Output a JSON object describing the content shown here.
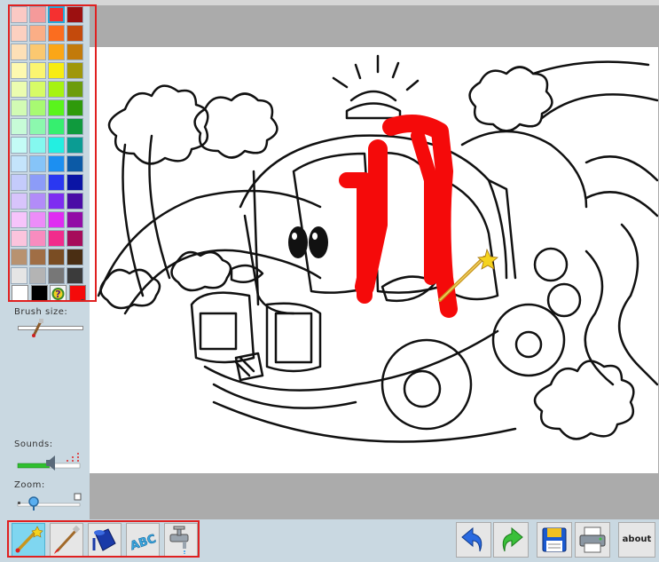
{
  "palette": {
    "rows": [
      [
        "#fbc9c4",
        "#f59a9a",
        "#f53030",
        "#9c1010"
      ],
      [
        "#fcd0c0",
        "#fbae86",
        "#fb6d1f",
        "#c44a0c"
      ],
      [
        "#fde0b7",
        "#fbc870",
        "#fba617",
        "#c27a0a"
      ],
      [
        "#fdf9b0",
        "#fbf570",
        "#f7ec12",
        "#9f970a"
      ],
      [
        "#ebfcb0",
        "#d7fb66",
        "#a6f312",
        "#6c9c0b"
      ],
      [
        "#d2fbb4",
        "#a8fa72",
        "#5af41c",
        "#2f9a0b"
      ],
      [
        "#c7fbd7",
        "#8cf8ae",
        "#36ef6f",
        "#0f9a3d"
      ],
      [
        "#c4fbf6",
        "#85f8ef",
        "#23efe1",
        "#0b9c93"
      ],
      [
        "#c4e4fb",
        "#86c4f8",
        "#1c8ff1",
        "#0c5aa6"
      ],
      [
        "#c4cbfb",
        "#8c9cf8",
        "#2a38f1",
        "#0a14a5"
      ],
      [
        "#d8c4fb",
        "#b28cf8",
        "#7e2cf1",
        "#4a0ca6"
      ],
      [
        "#f6c4fb",
        "#ec8cf8",
        "#df2cf1",
        "#920ca6"
      ],
      [
        "#fbc4dd",
        "#f88cbf",
        "#f12c8c",
        "#a60c5a"
      ],
      [
        "#b89270",
        "#a06e45",
        "#7a4d23",
        "#4a2e13"
      ],
      [
        "#e5e5e5",
        "#b4b4b4",
        "#777777",
        "#3b3b3b"
      ]
    ],
    "selected_swatch": "#f53030",
    "special": {
      "white": "#ffffff",
      "black": "#000000",
      "current": "#f50a0a",
      "random_icon": "question-mark-icon"
    }
  },
  "panel": {
    "brush_size_label": "Brush size:",
    "sounds_label": "Sounds:",
    "zoom_label": "Zoom:",
    "brush_size_level": 0.2,
    "sound_level": 0.5,
    "zoom_level": 0.2
  },
  "tools": [
    {
      "name": "magic-wand",
      "icon": "magic-wand-icon",
      "active": true
    },
    {
      "name": "brush",
      "icon": "brush-icon",
      "active": false
    },
    {
      "name": "paint-bucket",
      "icon": "paint-bucket-icon",
      "active": false
    },
    {
      "name": "text",
      "icon": "abc-text-icon",
      "label": "ABC",
      "active": false
    },
    {
      "name": "faucet",
      "icon": "faucet-icon",
      "active": false
    }
  ],
  "actions": {
    "undo_icon": "undo-arrow-icon",
    "redo_icon": "redo-arrow-icon",
    "save_icon": "floppy-disk-icon",
    "print_icon": "printer-icon",
    "about_label": "about"
  },
  "colors": {
    "panel_bg": "#c9d8e1",
    "canvas_bg": "#ababab",
    "highlight": "#e02020",
    "paint_red": "#f50a0a"
  }
}
